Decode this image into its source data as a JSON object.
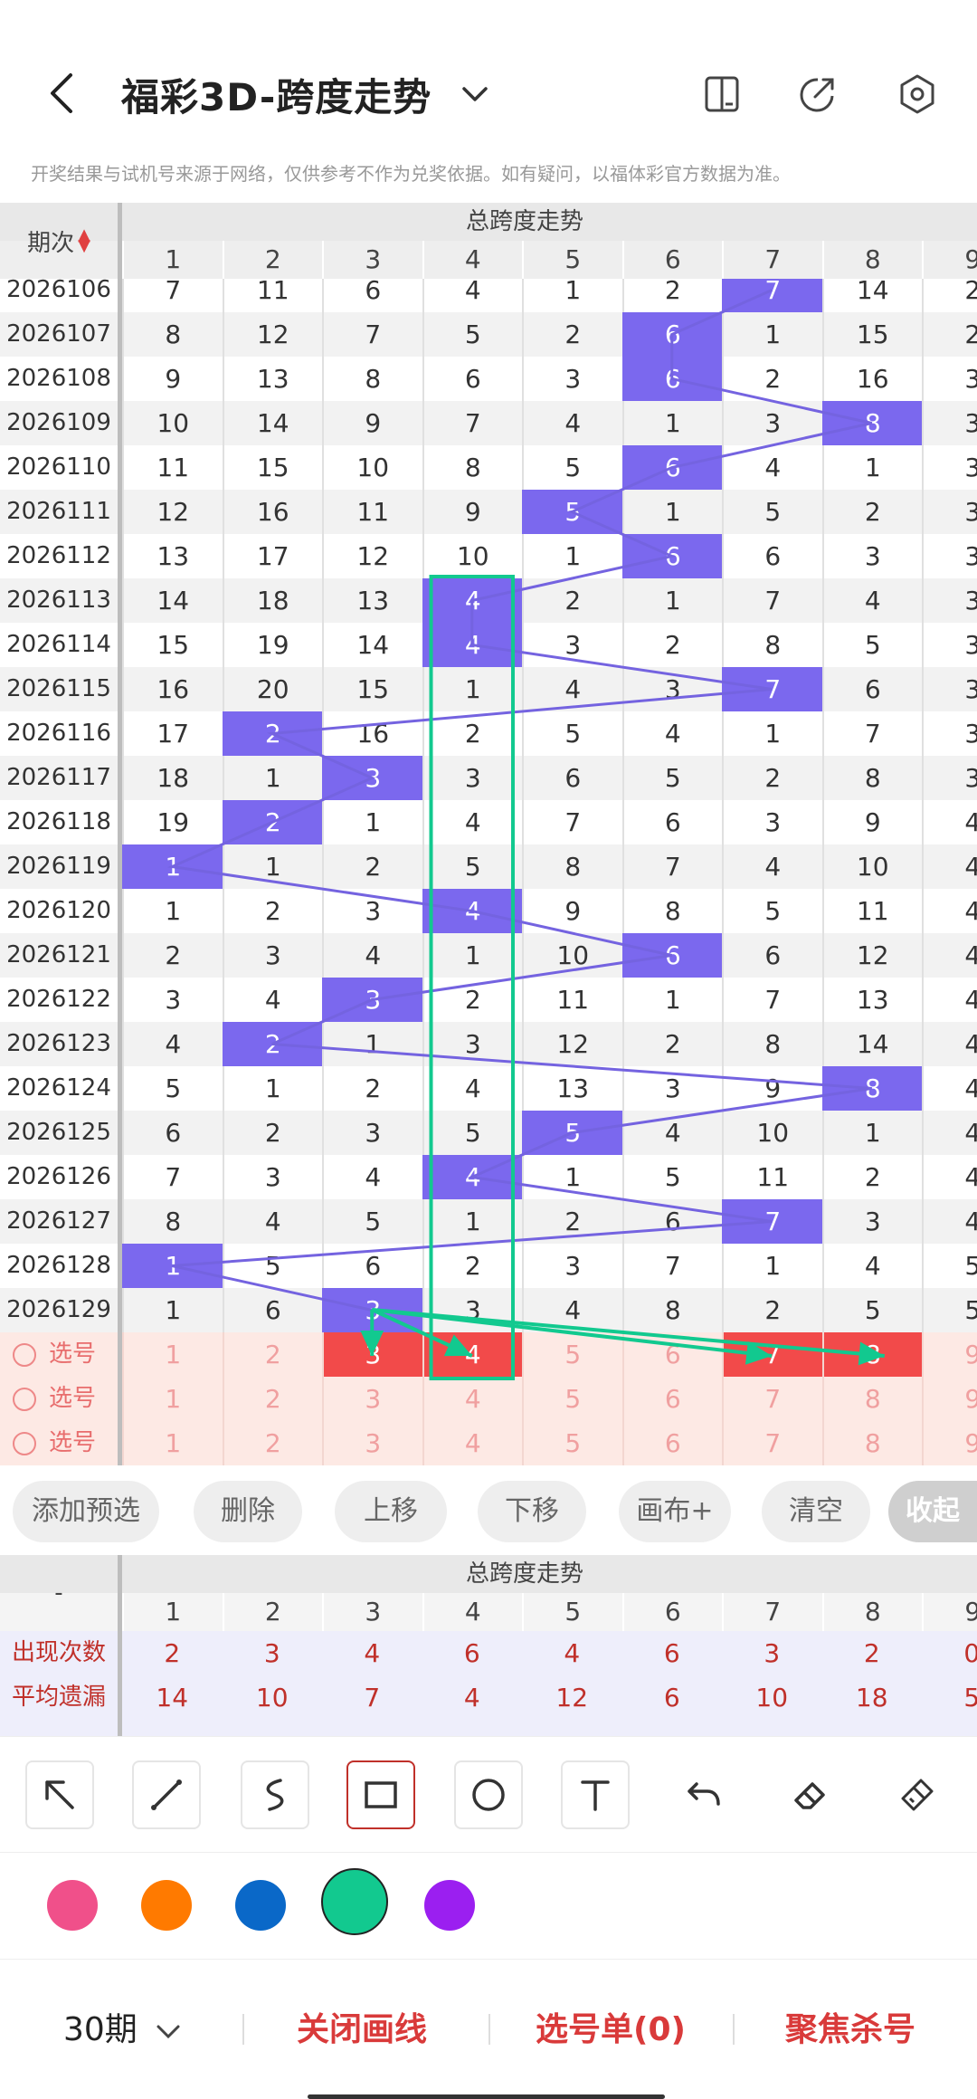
{
  "header": {
    "title": "福彩3D-跨度走势",
    "notice": "开奖结果与试机号来源于网络，仅供参考不作为兑奖依据。如有疑问，以福体彩官方数据为准。"
  },
  "grid": {
    "title": "总跨度走势",
    "period_label": "期次",
    "columns": [
      "1",
      "2",
      "3",
      "4",
      "5",
      "6",
      "7",
      "8",
      "9"
    ],
    "rows": [
      {
        "id": "2026106",
        "vals": [
          "7",
          "11",
          "6",
          "4",
          "1",
          "2",
          "7",
          "14",
          "2"
        ],
        "hit": 6
      },
      {
        "id": "2026107",
        "vals": [
          "8",
          "12",
          "7",
          "5",
          "2",
          "6",
          "1",
          "15",
          "2"
        ],
        "hit": 5
      },
      {
        "id": "2026108",
        "vals": [
          "9",
          "13",
          "8",
          "6",
          "3",
          "6",
          "2",
          "16",
          "3"
        ],
        "hit": 5
      },
      {
        "id": "2026109",
        "vals": [
          "10",
          "14",
          "9",
          "7",
          "4",
          "1",
          "3",
          "8",
          "3"
        ],
        "hit": 7
      },
      {
        "id": "2026110",
        "vals": [
          "11",
          "15",
          "10",
          "8",
          "5",
          "6",
          "4",
          "1",
          "3"
        ],
        "hit": 5
      },
      {
        "id": "2026111",
        "vals": [
          "12",
          "16",
          "11",
          "9",
          "5",
          "1",
          "5",
          "2",
          "3"
        ],
        "hit": 4
      },
      {
        "id": "2026112",
        "vals": [
          "13",
          "17",
          "12",
          "10",
          "1",
          "6",
          "6",
          "3",
          "3"
        ],
        "hit": 5
      },
      {
        "id": "2026113",
        "vals": [
          "14",
          "18",
          "13",
          "4",
          "2",
          "1",
          "7",
          "4",
          "3"
        ],
        "hit": 3
      },
      {
        "id": "2026114",
        "vals": [
          "15",
          "19",
          "14",
          "4",
          "3",
          "2",
          "8",
          "5",
          "3"
        ],
        "hit": 3
      },
      {
        "id": "2026115",
        "vals": [
          "16",
          "20",
          "15",
          "1",
          "4",
          "3",
          "7",
          "6",
          "3"
        ],
        "hit": 6
      },
      {
        "id": "2026116",
        "vals": [
          "17",
          "2",
          "16",
          "2",
          "5",
          "4",
          "1",
          "7",
          "3"
        ],
        "hit": 1
      },
      {
        "id": "2026117",
        "vals": [
          "18",
          "1",
          "3",
          "3",
          "6",
          "5",
          "2",
          "8",
          "3"
        ],
        "hit": 2
      },
      {
        "id": "2026118",
        "vals": [
          "19",
          "2",
          "1",
          "4",
          "7",
          "6",
          "3",
          "9",
          "4"
        ],
        "hit": 1
      },
      {
        "id": "2026119",
        "vals": [
          "1",
          "1",
          "2",
          "5",
          "8",
          "7",
          "4",
          "10",
          "4"
        ],
        "hit": 0
      },
      {
        "id": "2026120",
        "vals": [
          "1",
          "2",
          "3",
          "4",
          "9",
          "8",
          "5",
          "11",
          "4"
        ],
        "hit": 3
      },
      {
        "id": "2026121",
        "vals": [
          "2",
          "3",
          "4",
          "1",
          "10",
          "6",
          "6",
          "12",
          "4"
        ],
        "hit": 5
      },
      {
        "id": "2026122",
        "vals": [
          "3",
          "4",
          "3",
          "2",
          "11",
          "1",
          "7",
          "13",
          "4"
        ],
        "hit": 2
      },
      {
        "id": "2026123",
        "vals": [
          "4",
          "2",
          "1",
          "3",
          "12",
          "2",
          "8",
          "14",
          "4"
        ],
        "hit": 1
      },
      {
        "id": "2026124",
        "vals": [
          "5",
          "1",
          "2",
          "4",
          "13",
          "3",
          "9",
          "8",
          "4"
        ],
        "hit": 7
      },
      {
        "id": "2026125",
        "vals": [
          "6",
          "2",
          "3",
          "5",
          "5",
          "4",
          "10",
          "1",
          "4"
        ],
        "hit": 4
      },
      {
        "id": "2026126",
        "vals": [
          "7",
          "3",
          "4",
          "4",
          "1",
          "5",
          "11",
          "2",
          "4"
        ],
        "hit": 3
      },
      {
        "id": "2026127",
        "vals": [
          "8",
          "4",
          "5",
          "1",
          "2",
          "6",
          "7",
          "3",
          "4"
        ],
        "hit": 6
      },
      {
        "id": "2026128",
        "vals": [
          "1",
          "5",
          "6",
          "2",
          "3",
          "7",
          "1",
          "4",
          "5"
        ],
        "hit": 0
      },
      {
        "id": "2026129",
        "vals": [
          "1",
          "6",
          "3",
          "3",
          "4",
          "8",
          "2",
          "5",
          "5"
        ],
        "hit": 2
      }
    ],
    "select_rows": [
      {
        "label": "选号",
        "vals": [
          "1",
          "2",
          "3",
          "4",
          "5",
          "6",
          "7",
          "8",
          "9"
        ],
        "on": [
          2,
          3,
          6,
          7
        ]
      },
      {
        "label": "选号",
        "vals": [
          "1",
          "2",
          "3",
          "4",
          "5",
          "6",
          "7",
          "8",
          "9"
        ],
        "on": []
      },
      {
        "label": "选号",
        "vals": [
          "1",
          "2",
          "3",
          "4",
          "5",
          "6",
          "7",
          "8",
          "9"
        ],
        "on": []
      }
    ]
  },
  "actions": [
    "添加预选",
    "删除",
    "上移",
    "下移",
    "画布+",
    "清空",
    "收起"
  ],
  "stats": {
    "title": "总跨度走势",
    "dash": "-",
    "columns": [
      "1",
      "2",
      "3",
      "4",
      "5",
      "6",
      "7",
      "8",
      "9"
    ],
    "rows": [
      {
        "label": "出现次数",
        "vals": [
          "2",
          "3",
          "4",
          "6",
          "4",
          "6",
          "3",
          "2",
          "0"
        ]
      },
      {
        "label": "平均遗漏",
        "vals": [
          "14",
          "10",
          "7",
          "4",
          "12",
          "6",
          "10",
          "18",
          "5"
        ]
      }
    ]
  },
  "tools": [
    "select-arrow",
    "line",
    "curve",
    "rectangle",
    "circle",
    "text",
    "undo",
    "eraser",
    "clear-brush"
  ],
  "colors": [
    "#f0508a",
    "#ff7a00",
    "#0a68c8",
    "#12c98f",
    "#9b1ff0"
  ],
  "selected_color": "#12c98f",
  "bottom": {
    "periods": "30期",
    "close_draw": "关闭画线",
    "pick_list": "选号单(0)",
    "focus_kill": "聚焦杀号"
  }
}
